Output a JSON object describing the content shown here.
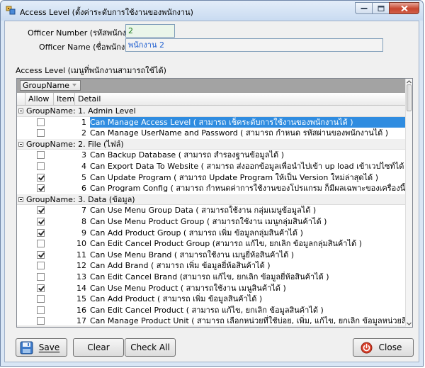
{
  "window": {
    "title": "Access Level (ตั้งค่าระดับการใช้งานของพนักงาน)"
  },
  "form": {
    "officer_number_label": "Officer Number (รหัสพนักงาน)",
    "officer_number_value": "2",
    "officer_name_label": "Officer Name (ชื่อพนักงาน)",
    "officer_name_value": "พนักงาน 2",
    "access_level_label": "Access Level (เมนูที่พนักงานสามารถใช้ได้)"
  },
  "grid": {
    "group_by_chip": "GroupName",
    "columns": {
      "allow": "Allow",
      "item": "Item",
      "detail": "Detail"
    },
    "rows": [
      {
        "kind": "group",
        "text": "GroupName:  1. Admin Level"
      },
      {
        "kind": "item",
        "checked": false,
        "item": "1",
        "detail": "Can Manage Access Level ( สามารถ เช็คระดับการใช้งานของพนักงานได้ )",
        "selected": true
      },
      {
        "kind": "item",
        "checked": false,
        "item": "2",
        "detail": "Can Manage UserName and Password ( สามารถ กำหนด รหัสผ่านของพนักงานได้ )"
      },
      {
        "kind": "group",
        "text": "GroupName:  2. File (ไฟล์)"
      },
      {
        "kind": "item",
        "checked": false,
        "item": "3",
        "detail": "Can Backup Database ( สามารถ สำรองฐานข้อมูลได้ )"
      },
      {
        "kind": "item",
        "checked": false,
        "item": "4",
        "detail": "Can Export Data To Website ( สามารถ ส่งออกข้อมูลเพื่อนำไปเข้า up load เข้าเวปไซท์ได้ )"
      },
      {
        "kind": "item",
        "checked": true,
        "item": "5",
        "detail": "Can Update Program ( สามารถ Update Program ให้เป็น Version ใหม่ล่าสุดได้ )"
      },
      {
        "kind": "item",
        "checked": true,
        "item": "6",
        "detail": "Can Program Config ( สามารถ กำหนดค่าการใช้งานของโปรแกรม ก็มีผลเฉพาะของเครื่องนี้ ได้ )"
      },
      {
        "kind": "group",
        "text": "GroupName:  3. Data (ข้อมูล)"
      },
      {
        "kind": "item",
        "checked": true,
        "item": "7",
        "detail": "Can Use Menu Group Data ( สามารถใช้งาน กลุ่มเมนูข้อมูลได้ )"
      },
      {
        "kind": "item",
        "checked": true,
        "item": "8",
        "detail": "Can Use Menu Product Group ( สามารถใช้งาน เมนูกลุ่มสินค้าได้ )"
      },
      {
        "kind": "item",
        "checked": true,
        "item": "9",
        "detail": "Can Add Product Group ( สามารถ เพิ่ม ข้อมูลกลุ่มสินค้าได้ )"
      },
      {
        "kind": "item",
        "checked": false,
        "item": "10",
        "detail": "Can Edit Cancel Product Group (สามารถ แก้ไข, ยกเลิก ข้อมูลกลุ่มสินค้าได้ )"
      },
      {
        "kind": "item",
        "checked": true,
        "item": "11",
        "detail": "Can Use Menu Brand ( สามารถใช้งาน เมนูยี่ห้อสินค้าได้ )"
      },
      {
        "kind": "item",
        "checked": false,
        "item": "12",
        "detail": "Can Add Brand ( สามารถ เพิ่ม ข้อมูลยี่ห้อสินค้าได้ )"
      },
      {
        "kind": "item",
        "checked": false,
        "item": "13",
        "detail": "Can Edit Cancel Brand (สามารถ แก้ไข, ยกเลิก ข้อมูลยี่ห้อสินค้าได้ )"
      },
      {
        "kind": "item",
        "checked": true,
        "item": "14",
        "detail": "Can Use Menu Product ( สามารถใช้งาน เมนูสินค้าได้ )"
      },
      {
        "kind": "item",
        "checked": false,
        "item": "15",
        "detail": "Can Add Product ( สามารถ เพิ่ม ข้อมูลสินค้าได้ )"
      },
      {
        "kind": "item",
        "checked": false,
        "item": "16",
        "detail": "Can Edit Cancel Product ( สามารถ แก้ไข, ยกเลิก ข้อมูลสินค้าได้ )"
      },
      {
        "kind": "item",
        "checked": false,
        "item": "17",
        "detail": "Can Manage Product Unit ( สามารถ เลือกหน่วยที่ใช้บ่อย, เพิ่ม, แก้ไข, ยกเลิก ข้อมูลหน่วยสินค้าได้ )"
      }
    ]
  },
  "buttons": {
    "save": "Save",
    "clear": "Clear",
    "check_all": "Check All",
    "close": "Close"
  },
  "icons": {
    "app": "key-app-icon",
    "save": "floppy-disk-icon",
    "close": "power-off-icon"
  },
  "colors": {
    "selection": "#2f8ce0",
    "officer_number_text": "#1a7a1a",
    "officer_name_text": "#1f5fd0"
  }
}
